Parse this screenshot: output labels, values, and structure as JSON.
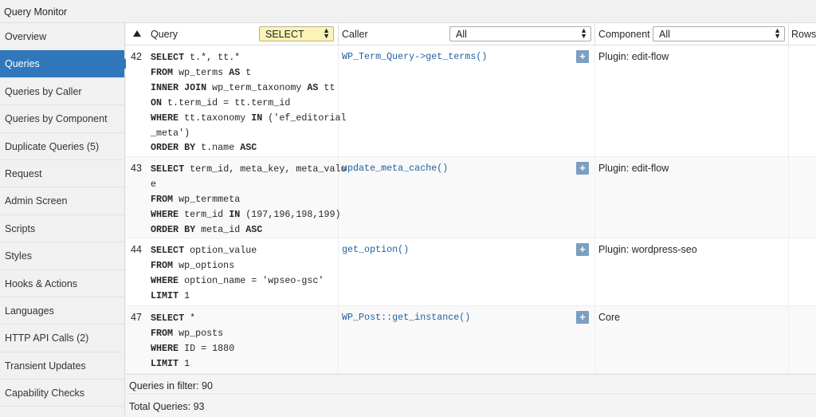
{
  "window": {
    "title": "Query Monitor"
  },
  "sidebar": {
    "items": [
      {
        "label": "Overview",
        "active": false
      },
      {
        "label": "Queries",
        "active": true
      },
      {
        "label": "Queries by Caller",
        "active": false
      },
      {
        "label": "Queries by Component",
        "active": false
      },
      {
        "label": "Duplicate Queries (5)",
        "active": false
      },
      {
        "label": "Request",
        "active": false
      },
      {
        "label": "Admin Screen",
        "active": false
      },
      {
        "label": "Scripts",
        "active": false
      },
      {
        "label": "Styles",
        "active": false
      },
      {
        "label": "Hooks & Actions",
        "active": false
      },
      {
        "label": "Languages",
        "active": false
      },
      {
        "label": "HTTP API Calls (2)",
        "active": false
      },
      {
        "label": "Transient Updates",
        "active": false
      },
      {
        "label": "Capability Checks",
        "active": false
      }
    ]
  },
  "table": {
    "headers": {
      "query": "Query",
      "query_filter": "SELECT",
      "caller": "Caller",
      "caller_filter": "All",
      "component": "Component",
      "component_filter": "All",
      "rows": "Rows"
    },
    "rows": [
      {
        "num": "42",
        "sql": [
          [
            [
              "k",
              "SELECT"
            ],
            [
              "t",
              " t.*, tt.*"
            ]
          ],
          [
            [
              "k",
              "FROM"
            ],
            [
              "t",
              " wp_terms "
            ],
            [
              "k",
              "AS"
            ],
            [
              "t",
              " t"
            ]
          ],
          [
            [
              "k",
              "INNER JOIN"
            ],
            [
              "t",
              " wp_term_taxonomy "
            ],
            [
              "k",
              "AS"
            ],
            [
              "t",
              " tt"
            ]
          ],
          [
            [
              "k",
              "ON"
            ],
            [
              "t",
              " t.term_id = tt.term_id"
            ]
          ],
          [
            [
              "k",
              "WHERE"
            ],
            [
              "t",
              " tt.taxonomy "
            ],
            [
              "k",
              "IN"
            ],
            [
              "t",
              " ('ef_editorial"
            ]
          ],
          [
            [
              "t",
              "_meta')"
            ]
          ],
          [
            [
              "k",
              "ORDER BY"
            ],
            [
              "t",
              " t.name "
            ],
            [
              "k",
              "ASC"
            ]
          ]
        ],
        "caller": "WP_Term_Query->get_terms()",
        "component": "Plugin: edit-flow"
      },
      {
        "num": "43",
        "sql": [
          [
            [
              "k",
              "SELECT"
            ],
            [
              "t",
              " term_id, meta_key, meta_valu"
            ]
          ],
          [
            [
              "t",
              "e"
            ]
          ],
          [
            [
              "k",
              "FROM"
            ],
            [
              "t",
              " wp_termmeta"
            ]
          ],
          [
            [
              "k",
              "WHERE"
            ],
            [
              "t",
              " term_id "
            ],
            [
              "k",
              "IN"
            ],
            [
              "t",
              " (197,196,198,199)"
            ]
          ],
          [
            [
              "k",
              "ORDER BY"
            ],
            [
              "t",
              " meta_id "
            ],
            [
              "k",
              "ASC"
            ]
          ]
        ],
        "caller": "update_meta_cache()",
        "component": "Plugin: edit-flow"
      },
      {
        "num": "44",
        "sql": [
          [
            [
              "k",
              "SELECT"
            ],
            [
              "t",
              " option_value"
            ]
          ],
          [
            [
              "k",
              "FROM"
            ],
            [
              "t",
              " wp_options"
            ]
          ],
          [
            [
              "k",
              "WHERE"
            ],
            [
              "t",
              " option_name = 'wpseo-gsc'"
            ]
          ],
          [
            [
              "k",
              "LIMIT"
            ],
            [
              "t",
              " 1"
            ]
          ]
        ],
        "caller": "get_option()",
        "component": "Plugin: wordpress-seo"
      },
      {
        "num": "47",
        "sql": [
          [
            [
              "k",
              "SELECT"
            ],
            [
              "t",
              " *"
            ]
          ],
          [
            [
              "k",
              "FROM"
            ],
            [
              "t",
              " wp_posts"
            ]
          ],
          [
            [
              "k",
              "WHERE"
            ],
            [
              "t",
              " ID = 1880"
            ]
          ],
          [
            [
              "k",
              "LIMIT"
            ],
            [
              "t",
              " 1"
            ]
          ]
        ],
        "caller": "WP_Post::get_instance()",
        "component": "Core"
      }
    ],
    "plus_label": "+"
  },
  "footer": {
    "in_filter": "Queries in filter: 90",
    "total": "Total Queries: 93"
  },
  "colors": {
    "accent": "#3077bb",
    "caller_link": "#1e5f9f",
    "filter_highlight": "#fcf4b6",
    "plus_button": "#7a9fc1"
  }
}
